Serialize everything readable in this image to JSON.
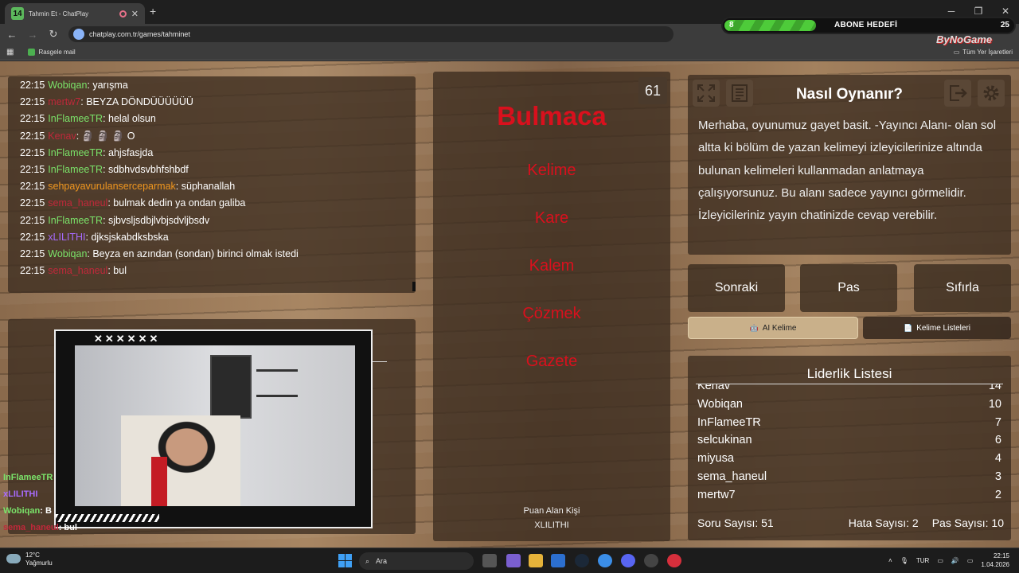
{
  "browser": {
    "tab_title": "Tahmin Et - ChatPlay",
    "tab_badge": "14",
    "url": "chatplay.com.tr/games/tahminet",
    "bookmark": "Rasgele mail",
    "all_bookmarks": "Tüm Yer İşaretleri"
  },
  "goal": {
    "current": "8",
    "title": "ABONE HEDEFİ",
    "max": "25",
    "progress": 0.32
  },
  "brand": "ByNoGame",
  "chat": [
    {
      "time": "22:15",
      "user": "Wobiqan",
      "color": "#7be36a",
      "msg": ": yarışma"
    },
    {
      "time": "22:15",
      "user": "mertw7",
      "color": "#c0283a",
      "msg": ": BEYZA DÖNDÜÜÜÜÜÜ"
    },
    {
      "time": "22:15",
      "user": "InFlameeTR",
      "color": "#7be36a",
      "msg": ": helal olsun"
    },
    {
      "time": "22:15",
      "user": "Kenav",
      "color": "#c0283a",
      "msg": ": 🗿 🗿 🗿 O"
    },
    {
      "time": "22:15",
      "user": "InFlameeTR",
      "color": "#7be36a",
      "msg": ": ahjsfasjda"
    },
    {
      "time": "22:15",
      "user": "InFlameeTR",
      "color": "#7be36a",
      "msg": ": sdbhvdsvbhfshbdf"
    },
    {
      "time": "22:15",
      "user": "sehpayavurulanserceparmak",
      "color": "#f0961e",
      "msg": ": süphanallah"
    },
    {
      "time": "22:15",
      "user": "sema_haneul",
      "color": "#c0283a",
      "msg": ": bulmak dedin ya ondan galiba"
    },
    {
      "time": "22:15",
      "user": "InFlameeTR",
      "color": "#7be36a",
      "msg": ": sjbvsljsdbjlvbjsdvljbsdv"
    },
    {
      "time": "22:15",
      "user": "xLILITHI",
      "color": "#a86bff",
      "msg": ": djksjskabdksbska"
    },
    {
      "time": "22:15",
      "user": "Wobiqan",
      "color": "#7be36a",
      "msg": ": Beyza en azından (sondan) birinci olmak istedi"
    },
    {
      "time": "22:15",
      "user": "sema_haneul",
      "color": "#c0283a",
      "msg": ": bul"
    }
  ],
  "game": {
    "timer": "61",
    "word": "Bulmaca",
    "taboo": [
      "Kelime",
      "Kare",
      "Kalem",
      "Çözmek",
      "Gazete"
    ],
    "scorer_label": "Puan Alan Kişi",
    "scorer_name": "XLILITHI"
  },
  "help": {
    "title": "Nasıl Oynanır?",
    "text": "Merhaba, oyunumuz gayet basit. -Yayıncı Alanı- olan sol altta ki bölüm de yazan kelimeyi izleyicilerinize altında bulunan kelimeleri kullanmadan anlatmaya çalışıyorsunuz. Bu alanı sadece yayıncı görmelidir. İzleyicileriniz yayın chatinizde cevap verebilir."
  },
  "actions": {
    "next": "Sonraki",
    "pass": "Pas",
    "reset": "Sıfırla",
    "ai_word": "AI Kelime",
    "word_lists": "Kelime Listeleri"
  },
  "leaderboard": {
    "title": "Liderlik Listesi",
    "rows": [
      {
        "name": "Kenav",
        "score": "14"
      },
      {
        "name": "Wobiqan",
        "score": "10"
      },
      {
        "name": "InFlameeTR",
        "score": "7"
      },
      {
        "name": "selcukinan",
        "score": "6"
      },
      {
        "name": "miyusa",
        "score": "4"
      },
      {
        "name": "sema_haneul",
        "score": "3"
      },
      {
        "name": "mertw7",
        "score": "2"
      }
    ],
    "question_count": "Soru Sayısı: 51",
    "error_count": "Hata Sayısı: 2",
    "pass_count": "Pas Sayısı: 10"
  },
  "overlay_chat": [
    {
      "user": "InFlameeTR",
      "color": "#7be36a",
      "msg": ""
    },
    {
      "user": "xLILITHI",
      "color": "#a86bff",
      "msg": ""
    },
    {
      "user": "Wobiqan",
      "color": "#7be36a",
      "msg": ": B"
    },
    {
      "user": "sema_haneul",
      "color": "#c0283a",
      "msg": ": bul"
    }
  ],
  "camera": {
    "x_marks": "✕✕✕✕✕✕"
  },
  "taskbar": {
    "temp": "12°C",
    "weather": "Yağmurlu",
    "search": "Ara",
    "lang": "TUR",
    "time": "22:15",
    "date": "1.04.2026"
  }
}
